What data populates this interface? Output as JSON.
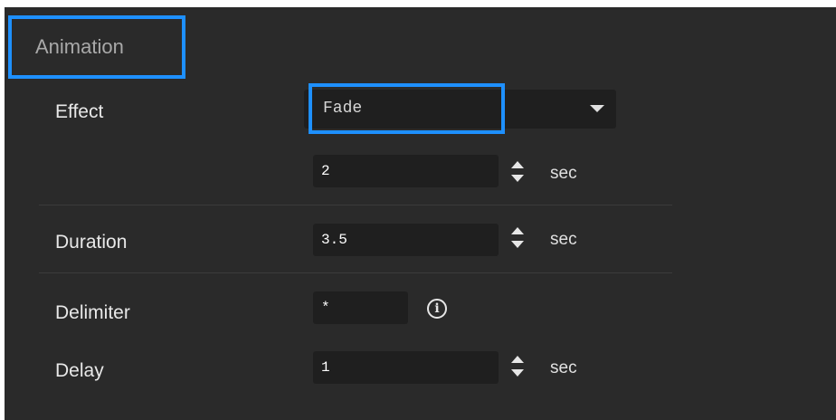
{
  "section": {
    "title": "Animation"
  },
  "effect": {
    "label": "Effect",
    "selected": "Fade",
    "icon": "chevron-down-icon"
  },
  "effect_time": {
    "value": "2",
    "unit": "sec"
  },
  "duration": {
    "label": "Duration",
    "value": "3.5",
    "unit": "sec"
  },
  "delimiter": {
    "label": "Delimiter",
    "value": "*",
    "info_icon": "info-icon"
  },
  "delay": {
    "label": "Delay",
    "value": "1",
    "unit": "sec"
  },
  "colors": {
    "highlight": "#1e90ff",
    "panel": "#2a2a2a",
    "field": "#1f1f1f"
  }
}
